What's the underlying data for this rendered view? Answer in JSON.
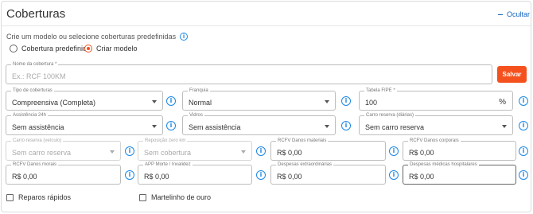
{
  "header": {
    "title": "Coberturas",
    "hide_label": "Ocultar"
  },
  "hint": "Crie um modelo ou selecione coberturas predefinidas",
  "mode": {
    "option_predefined": "Cobertura predefinida",
    "option_create": "Criar modelo",
    "selected": "Criar modelo"
  },
  "coverage_name": {
    "label": "Nome da cobertura *",
    "placeholder": "Ex.: RCF 100KM",
    "value": ""
  },
  "save_label": "Salvar",
  "fields": {
    "tipo": {
      "label": "Tipo de coberturas",
      "value": "Compreensiva (Completa)"
    },
    "franquia": {
      "label": "Franquia",
      "value": "Normal"
    },
    "tabela": {
      "label": "Tabela FIPE *",
      "value": "100",
      "suffix": "%"
    },
    "assistencia": {
      "label": "Assistência 24h",
      "value": "Sem assistência"
    },
    "vidros": {
      "label": "Vidros",
      "value": "Sem assistência"
    },
    "carro_reserva": {
      "label": "Carro reserva (diárias)",
      "value": "Sem carro reserva"
    },
    "carro_reserva_veiculo": {
      "label": "Carro reserva (veículo)",
      "value": "Sem carro reserva"
    },
    "reposicao": {
      "label": "Reposição zero km",
      "value": "Sem cobertura"
    },
    "rcfv_materiais": {
      "label": "RCFV Danos materiais",
      "value": "R$ 0,00"
    },
    "rcfv_corporais": {
      "label": "RCFV Danos corporais",
      "value": "R$ 0,00"
    },
    "rcfv_morais": {
      "label": "RCFV Danos morais",
      "value": "R$ 0,00"
    },
    "app": {
      "label": "APP Morte / Invalidez",
      "value": "R$ 0,00"
    },
    "despesas_extra": {
      "label": "Despesas extraordinárias",
      "value": "R$ 0,00"
    },
    "despesas_medicas": {
      "label": "Despesas médicas hospitalares",
      "value": "R$ 0,00"
    }
  },
  "checkboxes": {
    "reparos": "Reparos rápidos",
    "martelinho": "Martelinho de ouro"
  },
  "colors": {
    "accent": "#f4511e",
    "info": "#1e88e5",
    "link": "#1565c0"
  },
  "icons": {
    "info": "info-circle-icon",
    "dropdown": "chevron-down-icon"
  }
}
